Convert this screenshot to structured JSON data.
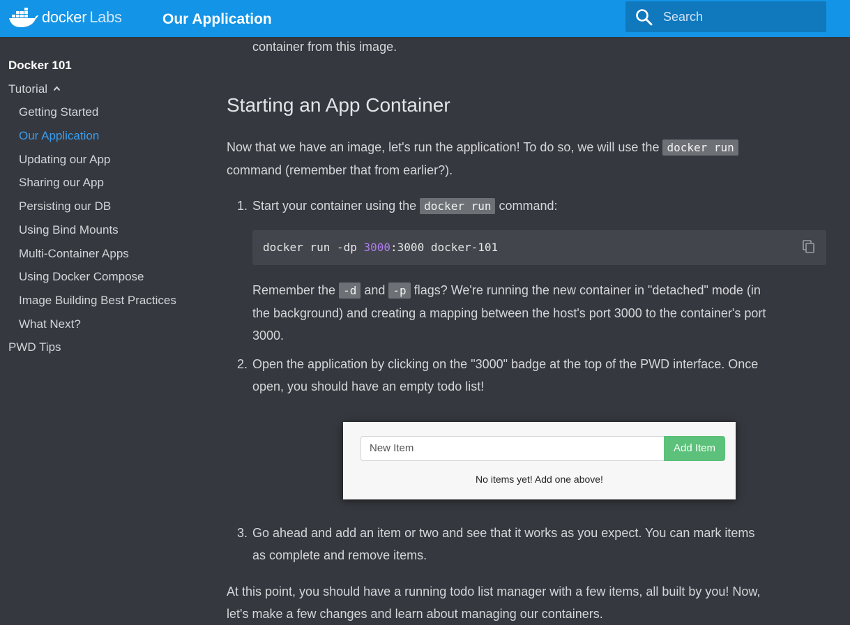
{
  "header": {
    "logo_text": "docker",
    "logo_sub": "Labs",
    "title": "Our Application",
    "search_placeholder": "Search",
    "brand_color": "#1394e6"
  },
  "sidebar": {
    "items": [
      {
        "label": "Docker 101",
        "state": "bold"
      },
      {
        "label": "Tutorial",
        "state": "expanded"
      },
      {
        "label": "Getting Started"
      },
      {
        "label": "Our Application",
        "state": "active"
      },
      {
        "label": "Updating our App"
      },
      {
        "label": "Sharing our App"
      },
      {
        "label": "Persisting our DB"
      },
      {
        "label": "Using Bind Mounts"
      },
      {
        "label": "Multi-Container Apps"
      },
      {
        "label": "Using Docker Compose"
      },
      {
        "label": "Image Building Best Practices"
      },
      {
        "label": "What Next?"
      },
      {
        "label": "PWD Tips"
      }
    ]
  },
  "content": {
    "top_text": "container from this image.",
    "section_title": "Starting an App Container",
    "intro": {
      "p1": "Now that we have an image, let's run the application! To do so, we will use the",
      "code": "docker run",
      "p2": "command (remember that from earlier?)."
    },
    "steps": [
      {
        "num": "1.",
        "p1": "Start your container using the",
        "code": "docker run",
        "p2": "command:"
      },
      {
        "num": "2.",
        "line1": "Open the application by clicking on the \"3000\" badge at the top of the PWD interface. Once",
        "line2": "open, you should have an empty todo list!"
      },
      {
        "num": "3.",
        "line1": "Go ahead and add an item or two and see that it works as you expect. You can mark items",
        "line2": "as complete and remove items."
      }
    ],
    "code_block": {
      "pre": "docker run -dp ",
      "number": "3000",
      "post": ":3000 docker-101"
    },
    "remember": {
      "t1": "Remember the",
      "c1": "-d",
      "t2": "and",
      "c2": "-p",
      "t3": "flags? We're running the new container in \"detached\" mode (in",
      "line2": "the background) and creating a mapping between the host's port 3000 to the container's port",
      "line3": "3000."
    },
    "todo_screenshot": {
      "input_placeholder": "New Item",
      "button_label": "Add Item",
      "empty_message": "No items yet! Add one above!"
    },
    "outro": {
      "line1": "At this point, you should have a running todo list manager with a few items, all built by you! Now,",
      "line2": "let's make a few changes and learn about managing our containers."
    }
  }
}
